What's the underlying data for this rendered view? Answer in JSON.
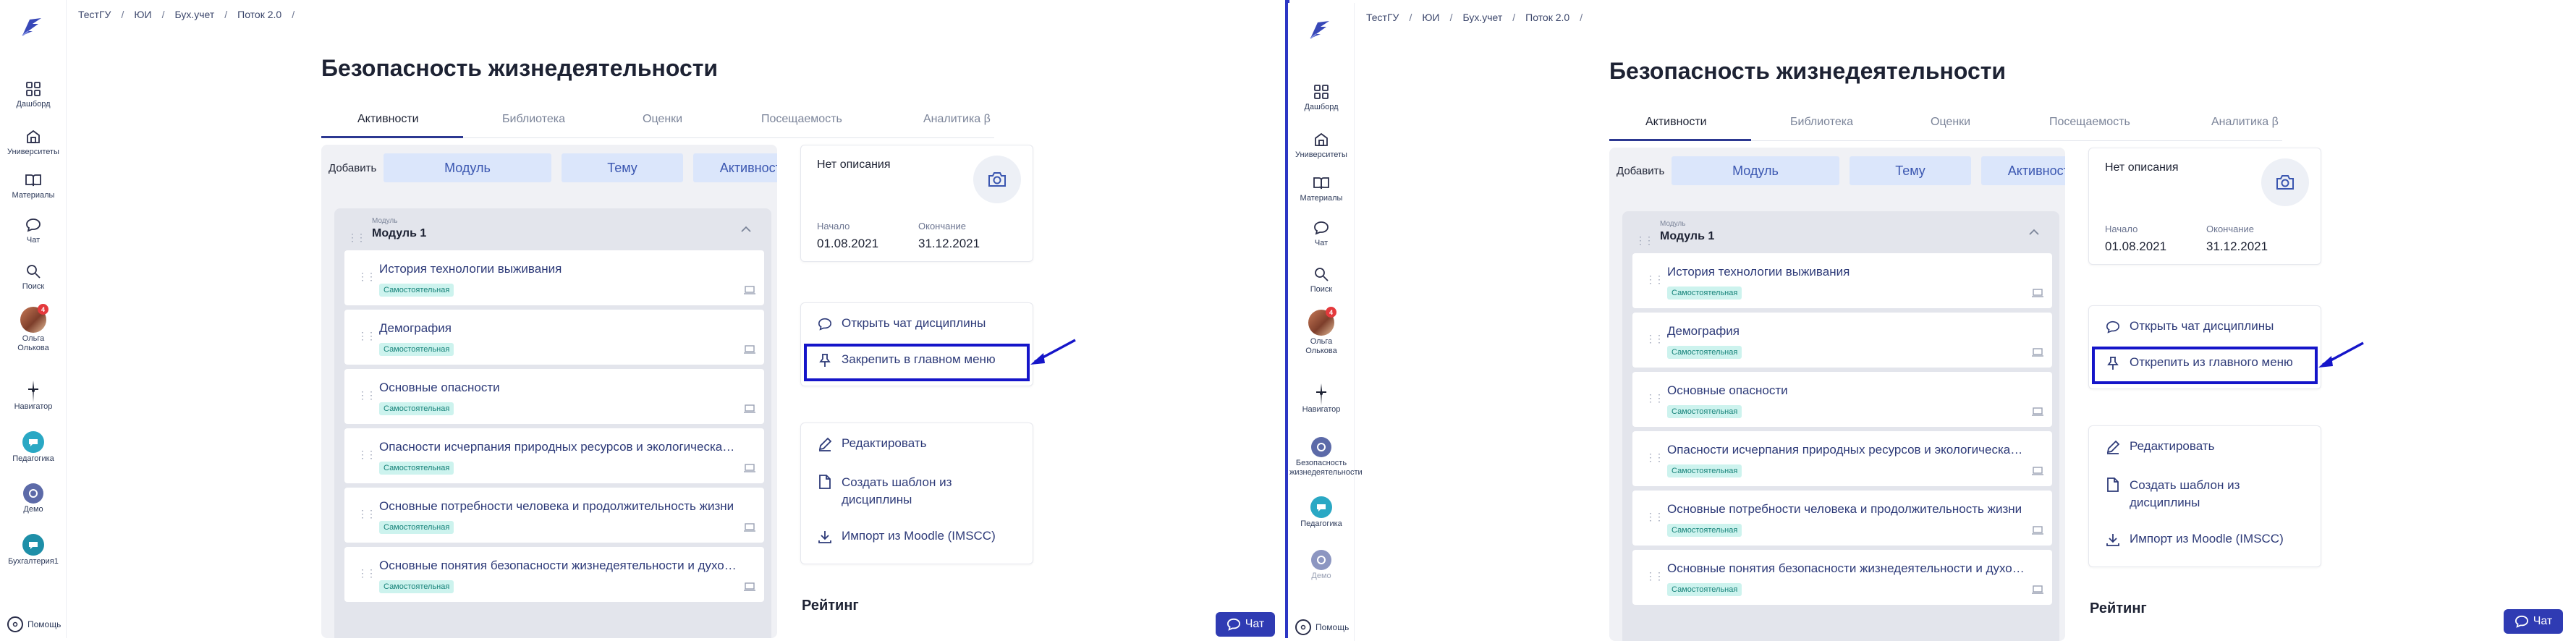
{
  "breadcrumb": [
    "ТестГУ",
    "ЮИ",
    "Бух.учет",
    "Поток 2.0"
  ],
  "breadcrumb_sep": "/",
  "course_title": "Безопасность жизнедеятельности",
  "tabs": [
    "Активности",
    "Библиотека",
    "Оценки",
    "Посещаемость",
    "Аналитика β"
  ],
  "add_label": "Добавить",
  "add_buttons": [
    "Модуль",
    "Тему",
    "Активность"
  ],
  "module": {
    "caption": "Модуль",
    "title": "Модуль 1"
  },
  "lessons": [
    {
      "title": "История технологии выживания",
      "tag": "Самостоятельная"
    },
    {
      "title": "Демография",
      "tag": "Самостоятельная"
    },
    {
      "title": "Основные опасности",
      "tag": "Самостоятельная"
    },
    {
      "title": "Опасности исчерпания природных ресурсов и экологическая пробле",
      "tag": "Самостоятельная"
    },
    {
      "title": "Основные потребности человека и продолжительность жизни",
      "tag": "Самостоятельная"
    },
    {
      "title": "Основные понятия безопасности жизнедеятельности и духовное разв",
      "tag": "Самостоятельная"
    }
  ],
  "info": {
    "no_description": "Нет описания",
    "start_label": "Начало",
    "start_value": "01.08.2021",
    "end_label": "Окончание",
    "end_value": "31.12.2021"
  },
  "actions": {
    "open_chat": "Открыть чат дисциплины",
    "edit": "Редактировать",
    "create_template": "Создать шаблон из дисциплины",
    "import": "Импорт из Moodle (IMSCC)"
  },
  "rating_title": "Рейтинг",
  "chat_fab": "Чат",
  "help": "Помощь",
  "badge_count": "4",
  "frame1": {
    "pin_label": "Закрепить в главном меню",
    "nav": {
      "dashboard": "Дашборд",
      "universities": "Университеты",
      "materials": "Материалы",
      "chat": "Чат",
      "search": "Поиск",
      "user": "Ольга Олькова",
      "navigator": "Навигатор",
      "pedagogy": "Педагогика",
      "demo": "Демо",
      "accounting": "Бухгалтерия1"
    }
  },
  "frame2": {
    "pin_label": "Открепить из главного меню",
    "nav": {
      "dashboard": "Дашборд",
      "universities": "Университеты",
      "materials": "Материалы",
      "chat": "Чат",
      "search": "Поиск",
      "user": "Ольга Олькова",
      "navigator": "Навигатор",
      "bzh": "Безопасность жизнедеятельности",
      "pedagogy": "Педагогика",
      "demo": "Демо"
    }
  },
  "colors": {
    "accent": "#2c3891",
    "highlight": "#1515c9",
    "tag_bg": "#cdf3ee",
    "button_bg": "#dbe6fb"
  }
}
